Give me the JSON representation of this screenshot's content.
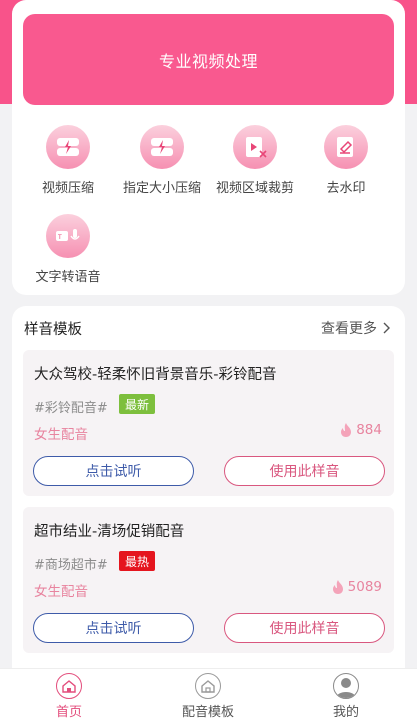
{
  "banner": {
    "title": "专业视频处理"
  },
  "tools": [
    {
      "label": "视频压缩",
      "icon": "video-compress-icon"
    },
    {
      "label": "指定大小压缩",
      "icon": "size-compress-icon"
    },
    {
      "label": "视频区域裁剪",
      "icon": "video-crop-icon"
    },
    {
      "label": "去水印",
      "icon": "watermark-remove-icon"
    },
    {
      "label": "文字转语音",
      "icon": "text-to-speech-icon"
    }
  ],
  "templates_section": {
    "title": "样音模板",
    "more_label": "查看更多"
  },
  "templates": [
    {
      "title": "大众驾校-轻柔怀旧背景音乐-彩铃配音",
      "tag": "#彩铃配音#",
      "badge": "最新",
      "voice": "女生配音",
      "count": "884",
      "listen_label": "点击试听",
      "use_label": "使用此样音"
    },
    {
      "title": "超市结业-清场促销配音",
      "tag": "#商场超市#",
      "badge": "最热",
      "voice": "女生配音",
      "count": "5089",
      "listen_label": "点击试听",
      "use_label": "使用此样音"
    }
  ],
  "bottom_nav": [
    {
      "label": "首页",
      "active": true,
      "icon": "home-icon"
    },
    {
      "label": "配音模板",
      "active": false,
      "icon": "template-icon"
    },
    {
      "label": "我的",
      "active": false,
      "icon": "profile-icon"
    }
  ],
  "colors": {
    "brand_pink": "#f8538a",
    "listen_blue": "#3e5ba9",
    "use_pink": "#d9577f",
    "badge_new": "#7dbf3d",
    "badge_hot": "#e5151e"
  }
}
